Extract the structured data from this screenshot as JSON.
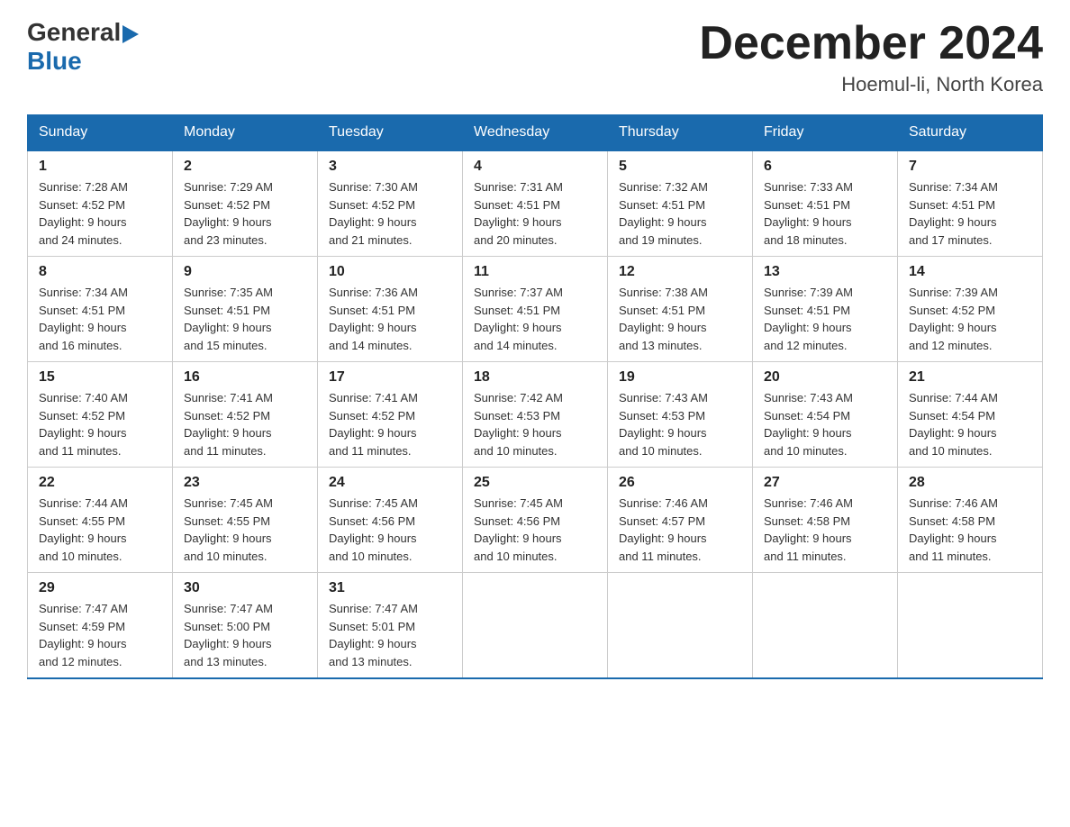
{
  "header": {
    "logo_general": "General",
    "logo_blue": "Blue",
    "title": "December 2024",
    "location": "Hoemul-li, North Korea"
  },
  "days_of_week": [
    "Sunday",
    "Monday",
    "Tuesday",
    "Wednesday",
    "Thursday",
    "Friday",
    "Saturday"
  ],
  "weeks": [
    [
      {
        "day": "1",
        "sunrise": "Sunrise: 7:28 AM",
        "sunset": "Sunset: 4:52 PM",
        "daylight": "Daylight: 9 hours",
        "daylight2": "and 24 minutes."
      },
      {
        "day": "2",
        "sunrise": "Sunrise: 7:29 AM",
        "sunset": "Sunset: 4:52 PM",
        "daylight": "Daylight: 9 hours",
        "daylight2": "and 23 minutes."
      },
      {
        "day": "3",
        "sunrise": "Sunrise: 7:30 AM",
        "sunset": "Sunset: 4:52 PM",
        "daylight": "Daylight: 9 hours",
        "daylight2": "and 21 minutes."
      },
      {
        "day": "4",
        "sunrise": "Sunrise: 7:31 AM",
        "sunset": "Sunset: 4:51 PM",
        "daylight": "Daylight: 9 hours",
        "daylight2": "and 20 minutes."
      },
      {
        "day": "5",
        "sunrise": "Sunrise: 7:32 AM",
        "sunset": "Sunset: 4:51 PM",
        "daylight": "Daylight: 9 hours",
        "daylight2": "and 19 minutes."
      },
      {
        "day": "6",
        "sunrise": "Sunrise: 7:33 AM",
        "sunset": "Sunset: 4:51 PM",
        "daylight": "Daylight: 9 hours",
        "daylight2": "and 18 minutes."
      },
      {
        "day": "7",
        "sunrise": "Sunrise: 7:34 AM",
        "sunset": "Sunset: 4:51 PM",
        "daylight": "Daylight: 9 hours",
        "daylight2": "and 17 minutes."
      }
    ],
    [
      {
        "day": "8",
        "sunrise": "Sunrise: 7:34 AM",
        "sunset": "Sunset: 4:51 PM",
        "daylight": "Daylight: 9 hours",
        "daylight2": "and 16 minutes."
      },
      {
        "day": "9",
        "sunrise": "Sunrise: 7:35 AM",
        "sunset": "Sunset: 4:51 PM",
        "daylight": "Daylight: 9 hours",
        "daylight2": "and 15 minutes."
      },
      {
        "day": "10",
        "sunrise": "Sunrise: 7:36 AM",
        "sunset": "Sunset: 4:51 PM",
        "daylight": "Daylight: 9 hours",
        "daylight2": "and 14 minutes."
      },
      {
        "day": "11",
        "sunrise": "Sunrise: 7:37 AM",
        "sunset": "Sunset: 4:51 PM",
        "daylight": "Daylight: 9 hours",
        "daylight2": "and 14 minutes."
      },
      {
        "day": "12",
        "sunrise": "Sunrise: 7:38 AM",
        "sunset": "Sunset: 4:51 PM",
        "daylight": "Daylight: 9 hours",
        "daylight2": "and 13 minutes."
      },
      {
        "day": "13",
        "sunrise": "Sunrise: 7:39 AM",
        "sunset": "Sunset: 4:51 PM",
        "daylight": "Daylight: 9 hours",
        "daylight2": "and 12 minutes."
      },
      {
        "day": "14",
        "sunrise": "Sunrise: 7:39 AM",
        "sunset": "Sunset: 4:52 PM",
        "daylight": "Daylight: 9 hours",
        "daylight2": "and 12 minutes."
      }
    ],
    [
      {
        "day": "15",
        "sunrise": "Sunrise: 7:40 AM",
        "sunset": "Sunset: 4:52 PM",
        "daylight": "Daylight: 9 hours",
        "daylight2": "and 11 minutes."
      },
      {
        "day": "16",
        "sunrise": "Sunrise: 7:41 AM",
        "sunset": "Sunset: 4:52 PM",
        "daylight": "Daylight: 9 hours",
        "daylight2": "and 11 minutes."
      },
      {
        "day": "17",
        "sunrise": "Sunrise: 7:41 AM",
        "sunset": "Sunset: 4:52 PM",
        "daylight": "Daylight: 9 hours",
        "daylight2": "and 11 minutes."
      },
      {
        "day": "18",
        "sunrise": "Sunrise: 7:42 AM",
        "sunset": "Sunset: 4:53 PM",
        "daylight": "Daylight: 9 hours",
        "daylight2": "and 10 minutes."
      },
      {
        "day": "19",
        "sunrise": "Sunrise: 7:43 AM",
        "sunset": "Sunset: 4:53 PM",
        "daylight": "Daylight: 9 hours",
        "daylight2": "and 10 minutes."
      },
      {
        "day": "20",
        "sunrise": "Sunrise: 7:43 AM",
        "sunset": "Sunset: 4:54 PM",
        "daylight": "Daylight: 9 hours",
        "daylight2": "and 10 minutes."
      },
      {
        "day": "21",
        "sunrise": "Sunrise: 7:44 AM",
        "sunset": "Sunset: 4:54 PM",
        "daylight": "Daylight: 9 hours",
        "daylight2": "and 10 minutes."
      }
    ],
    [
      {
        "day": "22",
        "sunrise": "Sunrise: 7:44 AM",
        "sunset": "Sunset: 4:55 PM",
        "daylight": "Daylight: 9 hours",
        "daylight2": "and 10 minutes."
      },
      {
        "day": "23",
        "sunrise": "Sunrise: 7:45 AM",
        "sunset": "Sunset: 4:55 PM",
        "daylight": "Daylight: 9 hours",
        "daylight2": "and 10 minutes."
      },
      {
        "day": "24",
        "sunrise": "Sunrise: 7:45 AM",
        "sunset": "Sunset: 4:56 PM",
        "daylight": "Daylight: 9 hours",
        "daylight2": "and 10 minutes."
      },
      {
        "day": "25",
        "sunrise": "Sunrise: 7:45 AM",
        "sunset": "Sunset: 4:56 PM",
        "daylight": "Daylight: 9 hours",
        "daylight2": "and 10 minutes."
      },
      {
        "day": "26",
        "sunrise": "Sunrise: 7:46 AM",
        "sunset": "Sunset: 4:57 PM",
        "daylight": "Daylight: 9 hours",
        "daylight2": "and 11 minutes."
      },
      {
        "day": "27",
        "sunrise": "Sunrise: 7:46 AM",
        "sunset": "Sunset: 4:58 PM",
        "daylight": "Daylight: 9 hours",
        "daylight2": "and 11 minutes."
      },
      {
        "day": "28",
        "sunrise": "Sunrise: 7:46 AM",
        "sunset": "Sunset: 4:58 PM",
        "daylight": "Daylight: 9 hours",
        "daylight2": "and 11 minutes."
      }
    ],
    [
      {
        "day": "29",
        "sunrise": "Sunrise: 7:47 AM",
        "sunset": "Sunset: 4:59 PM",
        "daylight": "Daylight: 9 hours",
        "daylight2": "and 12 minutes."
      },
      {
        "day": "30",
        "sunrise": "Sunrise: 7:47 AM",
        "sunset": "Sunset: 5:00 PM",
        "daylight": "Daylight: 9 hours",
        "daylight2": "and 13 minutes."
      },
      {
        "day": "31",
        "sunrise": "Sunrise: 7:47 AM",
        "sunset": "Sunset: 5:01 PM",
        "daylight": "Daylight: 9 hours",
        "daylight2": "and 13 minutes."
      },
      {
        "day": "",
        "sunrise": "",
        "sunset": "",
        "daylight": "",
        "daylight2": ""
      },
      {
        "day": "",
        "sunrise": "",
        "sunset": "",
        "daylight": "",
        "daylight2": ""
      },
      {
        "day": "",
        "sunrise": "",
        "sunset": "",
        "daylight": "",
        "daylight2": ""
      },
      {
        "day": "",
        "sunrise": "",
        "sunset": "",
        "daylight": "",
        "daylight2": ""
      }
    ]
  ]
}
